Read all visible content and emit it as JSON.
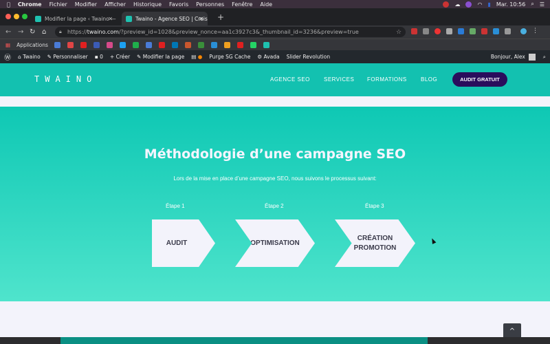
{
  "menubar": {
    "app": "Chrome",
    "items": [
      "Fichier",
      "Modifier",
      "Afficher",
      "Historique",
      "Favoris",
      "Personnes",
      "Fenêtre",
      "Aide"
    ],
    "clock": "Mar. 10:56"
  },
  "tabs": [
    {
      "title": "Modifier la page ‹ Twaino — W"
    },
    {
      "title": "Twaino - Agence SEO | Croiss"
    }
  ],
  "address": {
    "scheme": "https://",
    "host": "twaino.com",
    "path": "/?preview_id=1028&preview_nonce=aa1c3927c3&_thumbnail_id=3236&preview=true"
  },
  "bookmarks": {
    "apps_label": "Applications",
    "colors": [
      "#4a7bd6",
      "#e04545",
      "#e02020",
      "#3b5bb5",
      "#d64a8a",
      "#1da1f2",
      "#1fae4b",
      "#4a7bd6",
      "#e02020",
      "#0077b5",
      "#c9572e",
      "#3a8f3a",
      "#2a8fd6",
      "#f0a020",
      "#e02020",
      "#25d366",
      "#1ec1b0"
    ]
  },
  "wpbar": {
    "items": [
      "Twaino",
      "Personnaliser",
      "0",
      "Créer",
      "Modifier la page",
      "Purge SG Cache",
      "Avada",
      "Slider Revolution"
    ],
    "greeting": "Bonjour, Alex"
  },
  "site": {
    "logo": "TWAINO",
    "nav": [
      "AGENCE SEO",
      "SERVICES",
      "FORMATIONS",
      "BLOG"
    ],
    "cta": "AUDIT GRATUIT",
    "title": "Méthodologie d’une campagne SEO",
    "subtitle": "Lors de la mise en place d’une campagne SEO, nous suivons le processus suivant:",
    "steps": [
      {
        "label": "Étape 1",
        "name": "AUDIT"
      },
      {
        "label": "Étape 2",
        "name": "OPTIMISATION"
      },
      {
        "label": "Étape 3",
        "name": "CRÉATION PROMOTION"
      }
    ],
    "scroll_top": "^"
  },
  "colors": {
    "teal": "#13c1b0",
    "cta": "#2a0d5c",
    "panel": "#f3f3fb"
  }
}
